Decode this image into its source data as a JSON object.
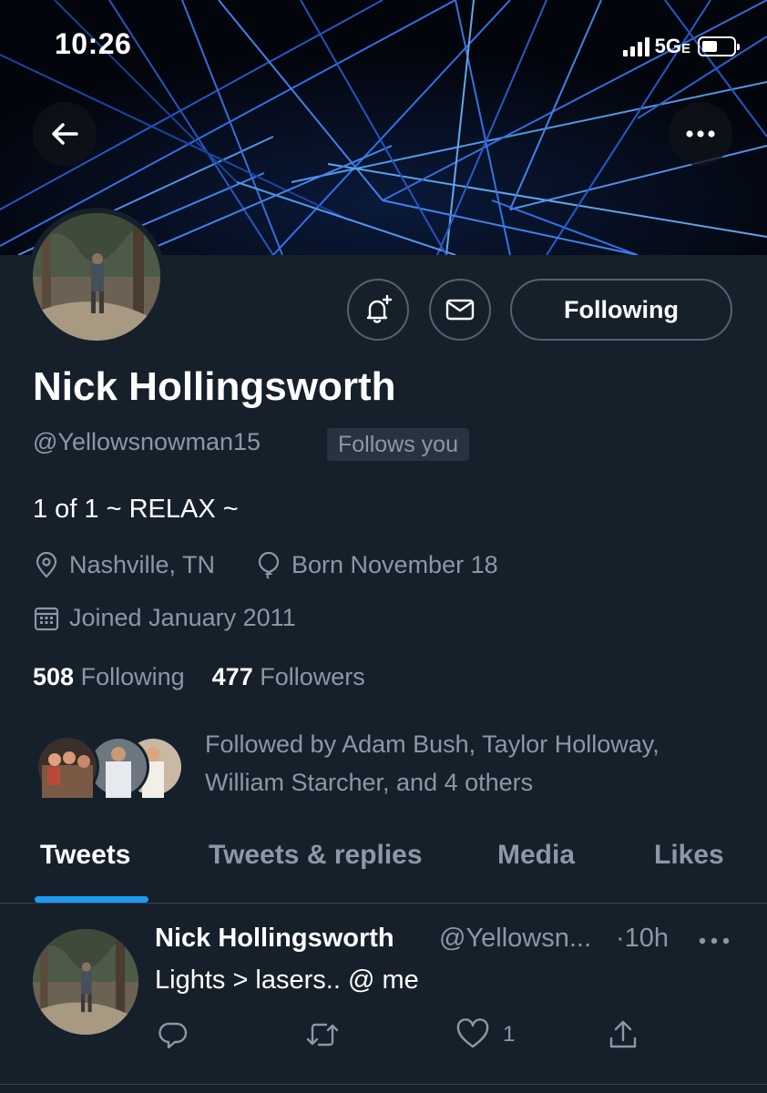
{
  "status_bar": {
    "time": "10:26",
    "network": "5G",
    "network_suffix": "E"
  },
  "profile": {
    "name": "Nick Hollingsworth",
    "handle": "@Yellowsnowman15",
    "follows_you": "Follows you",
    "follow_button": "Following",
    "bio": "1 of 1 ~ RELAX ~",
    "location": "Nashville, TN",
    "birthday": "Born November 18",
    "joined": "Joined January 2011",
    "following_count": "508",
    "following_label": "Following",
    "followers_count": "477",
    "followers_label": "Followers",
    "followed_by_line1": "Followed by Adam Bush, Taylor Holloway,",
    "followed_by_line2": "William Starcher, and 4 others"
  },
  "tabs": [
    {
      "label": "Tweets",
      "active": true
    },
    {
      "label": "Tweets & replies",
      "active": false
    },
    {
      "label": "Media",
      "active": false
    },
    {
      "label": "Likes",
      "active": false
    }
  ],
  "tweet": {
    "name": "Nick Hollingsworth",
    "handle": "@Yellowsn...",
    "time": "·10h",
    "text": "Lights > lasers.. @ me",
    "like_count": "1"
  },
  "colors": {
    "background": "#15202b",
    "accent": "#1d9bf0",
    "secondary_text": "#8b98a5",
    "border": "#536471"
  },
  "icons": [
    "back-arrow-icon",
    "more-icon",
    "bell-plus-icon",
    "mail-icon",
    "location-pin-icon",
    "balloon-icon",
    "calendar-icon",
    "reply-icon",
    "retweet-icon",
    "like-icon",
    "share-icon"
  ]
}
